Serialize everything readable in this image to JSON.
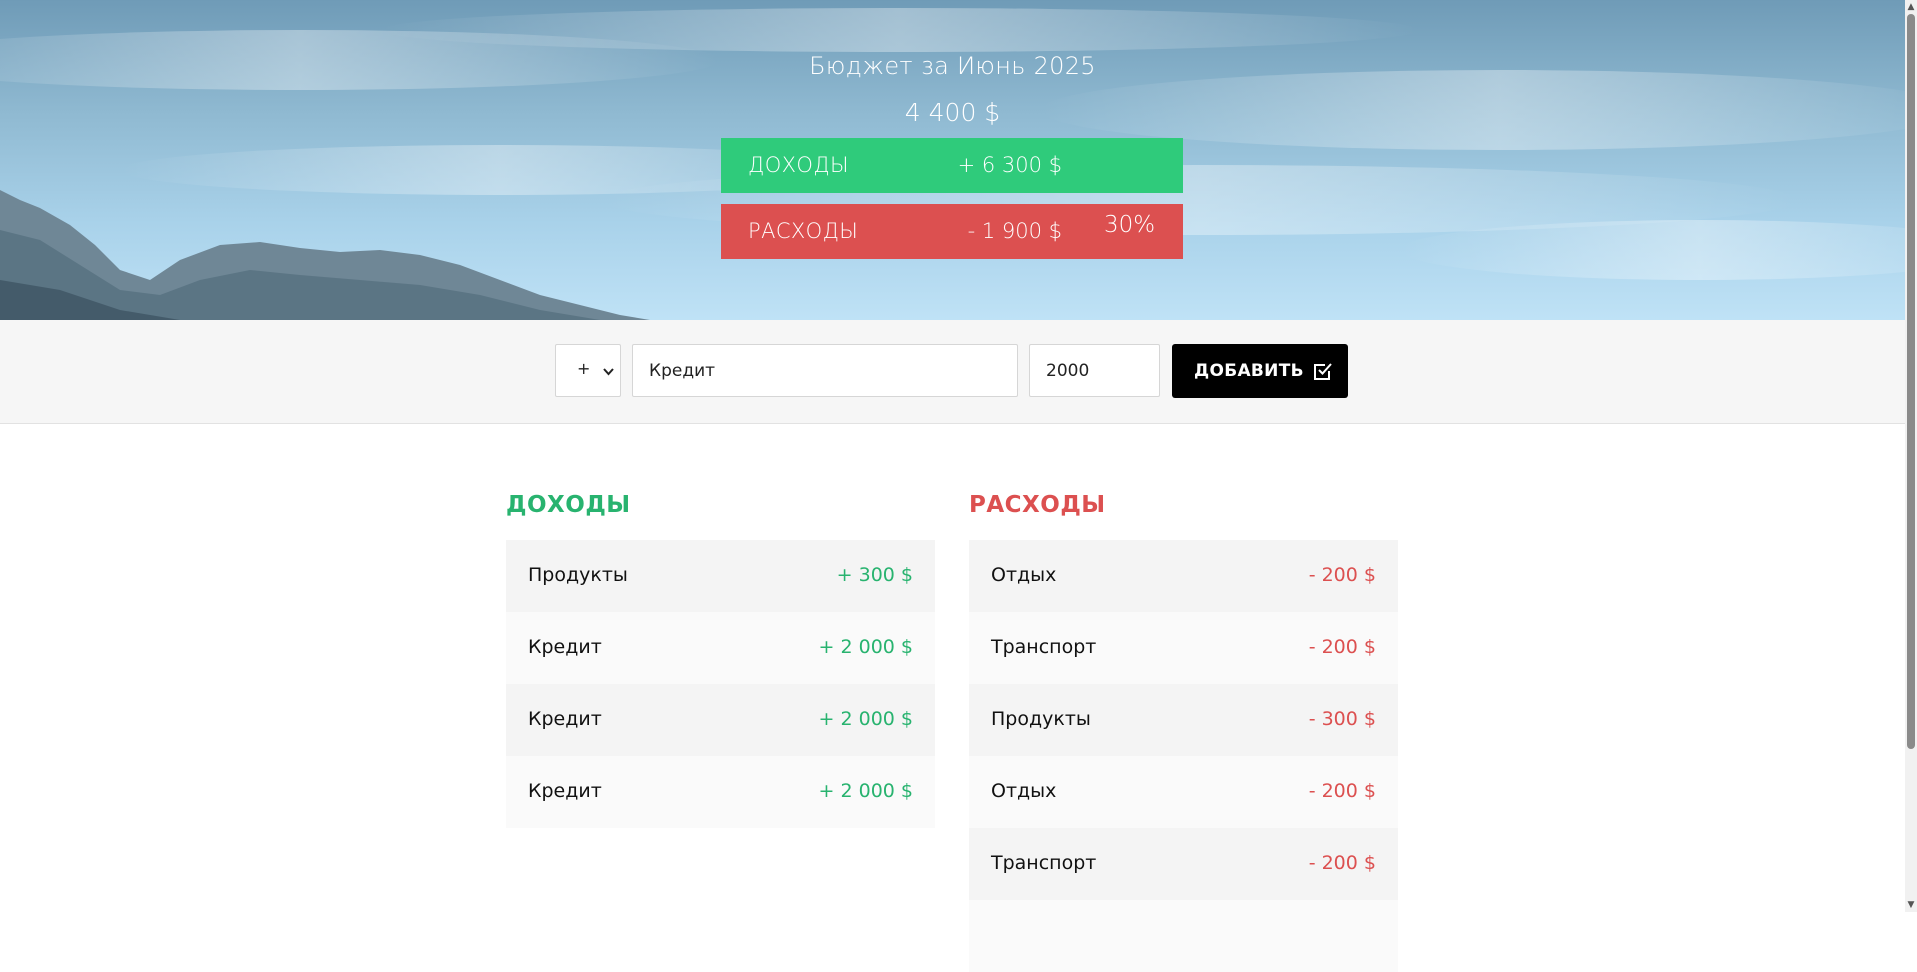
{
  "header": {
    "title": "Бюджет за Июнь 2025",
    "total": "4 400 $",
    "income": {
      "label": "ДОХОДЫ",
      "value": "+ 6 300 $"
    },
    "expense": {
      "label": "РАСХОДЫ",
      "value": "- 1 900 $",
      "percent": "30%"
    }
  },
  "add_form": {
    "type_options": [
      "+"
    ],
    "type_selected": "+",
    "description_value": "Кредит",
    "value_value": "2000",
    "button_label": "ДОБАВИТЬ"
  },
  "income_list": {
    "title": "ДОХОДЫ",
    "items": [
      {
        "desc": "Продукты",
        "amount": "+ 300 $"
      },
      {
        "desc": "Кредит",
        "amount": "+ 2 000 $"
      },
      {
        "desc": "Кредит",
        "amount": "+ 2 000 $"
      },
      {
        "desc": "Кредит",
        "amount": "+ 2 000 $"
      }
    ]
  },
  "expense_list": {
    "title": "РАСХОДЫ",
    "items": [
      {
        "desc": "Отдых",
        "amount": "- 200 $"
      },
      {
        "desc": "Транспорт",
        "amount": "- 200 $"
      },
      {
        "desc": "Продукты",
        "amount": "- 300 $"
      },
      {
        "desc": "Отдых",
        "amount": "- 200 $"
      },
      {
        "desc": "Транспорт",
        "amount": "- 200 $"
      },
      {
        "desc": "",
        "amount": ""
      }
    ]
  },
  "colors": {
    "income": "#2fcb7b",
    "expense": "#dc5050",
    "button": "#000000"
  },
  "icons": {
    "add_button": "checkbox-icon",
    "select": "chevron-down-icon"
  }
}
